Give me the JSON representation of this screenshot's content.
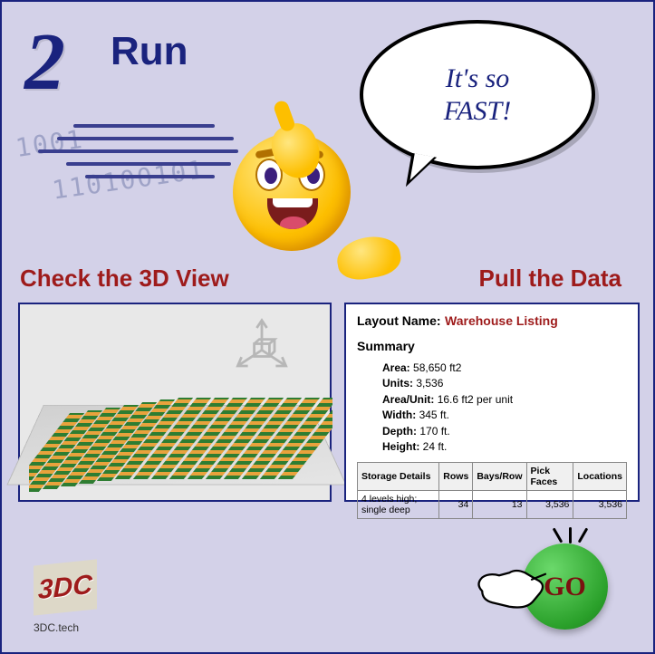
{
  "step": {
    "number": "2",
    "title": "Run"
  },
  "binary": {
    "line1": "1001",
    "line2": "110100101"
  },
  "speech": {
    "line1": "It's so",
    "line2": "FAST!"
  },
  "sections": {
    "left": "Check the 3D View",
    "right": "Pull the Data"
  },
  "data_panel": {
    "layout_label": "Layout Name:",
    "layout_name": "Warehouse Listing",
    "summary_heading": "Summary",
    "summary": {
      "area_label": "Area:",
      "area_value": "58,650 ft2",
      "units_label": "Units:",
      "units_value": "3,536",
      "areaunit_label": "Area/Unit:",
      "areaunit_value": "16.6 ft2 per unit",
      "width_label": "Width:",
      "width_value": "345 ft.",
      "depth_label": "Depth:",
      "depth_value": "170 ft.",
      "height_label": "Height:",
      "height_value": "24 ft."
    },
    "table": {
      "headers": {
        "c1": "Storage Details",
        "c2": "Rows",
        "c3": "Bays/Row",
        "c4": "Pick Faces",
        "c5": "Locations"
      },
      "row": {
        "c1": "4 levels high; single deep",
        "c2": "34",
        "c3": "13",
        "c4": "3,536",
        "c5": "3,536"
      }
    }
  },
  "logo": {
    "text": "3DC",
    "sub": "3DC.tech"
  },
  "go": {
    "label": "GO"
  }
}
